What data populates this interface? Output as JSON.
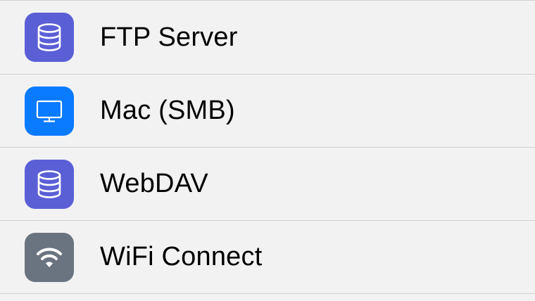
{
  "items": [
    {
      "label": "FTP Server",
      "icon": "database-icon",
      "color": "#5b5fd6"
    },
    {
      "label": "Mac (SMB)",
      "icon": "monitor-icon",
      "color": "#0a7aff"
    },
    {
      "label": "WebDAV",
      "icon": "database-icon",
      "color": "#5b5fd6"
    },
    {
      "label": "WiFi Connect",
      "icon": "wifi-icon",
      "color": "#6a7480"
    }
  ]
}
